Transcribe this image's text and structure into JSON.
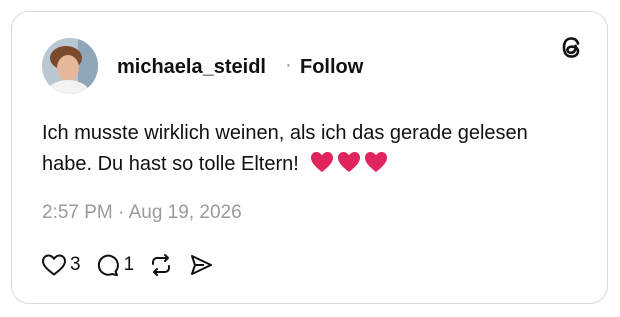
{
  "post": {
    "username": "michaela_steidl",
    "separator": "·",
    "follow_label": "Follow",
    "text": "Ich musste wirklich weinen, als ich das gerade gelesen habe. Du hast so tolle Eltern!",
    "emoji": "❤️❤️❤️",
    "timestamp": "2:57 PM · Aug 19, 2026"
  },
  "actions": {
    "likes": "3",
    "replies": "1"
  },
  "icons": [
    "avatar",
    "threads-logo-icon",
    "heart-icon",
    "comment-icon",
    "repost-icon",
    "share-icon"
  ],
  "colors": {
    "text": "#111111",
    "muted": "#9a9a9a",
    "border": "#d9d9d9",
    "heart": "#e0245e"
  }
}
